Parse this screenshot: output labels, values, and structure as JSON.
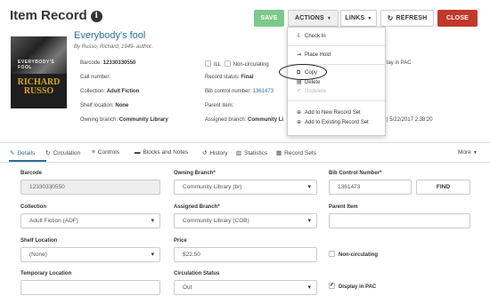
{
  "header": {
    "title": "Item Record",
    "info_icon_glyph": "i",
    "save_label": "SAVE",
    "actions_label": "ACTIONS",
    "links_label": "LINKS",
    "refresh_label": "REFRESH",
    "close_label": "CLOSE"
  },
  "colors": {
    "save_bg": "#7dc88a",
    "close_bg": "#c0392b",
    "link": "#2a6f9a"
  },
  "cover": {
    "author_top": "RICHARD",
    "author_bottom": "RUSSO",
    "title_text": "EVERYBODY'S FOOL"
  },
  "record": {
    "title": "Everybody's fool",
    "byline": "By Russo, Richard, 1949- author.",
    "barcode_label": "Barcode:",
    "barcode": "12330330550",
    "call_number_label": "Call number:",
    "collection_label": "Collection:",
    "collection": "Adult Fiction",
    "shelf_location_label": "Shelf location:",
    "shelf_location": "None",
    "owning_branch_label": "Owning branch:",
    "owning_branch": "Community Library",
    "ill_label": "ILL",
    "non_circulating_label": "Non-circulating",
    "display_in_pac_partial": "lay in PAC",
    "record_status_label": "Record status:",
    "record_status": "Final",
    "bib_control_label": "Bib control number:",
    "bib_control": "1361473",
    "parent_item_label": "Parent item:",
    "assigned_branch_label": "Assigned branch:",
    "assigned_branch_partial": "Community Li",
    "date_partial": "| 5/22/2017 2:38:20"
  },
  "actions_menu": {
    "check_in": "Check In",
    "place_hold": "Place Hold",
    "copy": "Copy",
    "delete": "Delete",
    "undelete": "Undelete",
    "add_new_record_set": "Add to New Record Set",
    "add_existing_record_set": "Add to Existing Record Set"
  },
  "tabs": {
    "details": "Details",
    "circulation": "Circulation",
    "controls": "Controls",
    "blocks_notes": "Blocks and Notes",
    "history": "History",
    "statistics": "Statistics",
    "record_sets": "Record Sets",
    "more": "More"
  },
  "form": {
    "barcode_label": "Barcode",
    "barcode_value": "12330330550",
    "owning_branch_label": "Owning Branch*",
    "owning_branch_value": "Community Library (br)",
    "bib_control_label": "Bib Control Number*",
    "bib_control_value": "1361473",
    "find_label": "FIND",
    "collection_label": "Collection",
    "collection_value": "Adult Fiction (ADF)",
    "assigned_branch_label": "Assigned Branch*",
    "assigned_branch_value": "Community Library (COB)",
    "parent_item_label": "Parent Item",
    "parent_item_value": "",
    "shelf_location_label": "Shelf Location",
    "shelf_location_value": "(None)",
    "price_label": "Price",
    "price_value": "$22.50",
    "non_circulating_label": "Non-circulating",
    "temporary_location_label": "Temporary Location",
    "temporary_location_value": "",
    "circulation_status_label": "Circulation Status",
    "circulation_status_value": "Out",
    "display_in_pac_label": "Display in PAC",
    "non_circulating_checked": false,
    "display_in_pac_checked": true
  }
}
